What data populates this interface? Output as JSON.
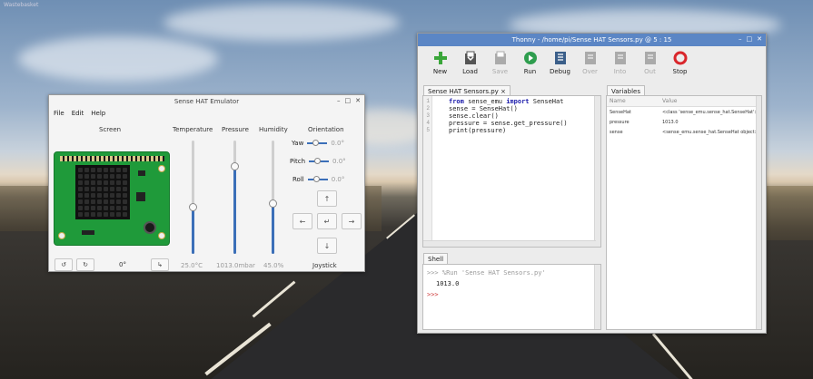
{
  "desktop": {
    "corner_text": "Wastebasket"
  },
  "emulator": {
    "title": "Sense HAT Emulator",
    "menu": [
      "File",
      "Edit",
      "Help"
    ],
    "screen_label": "Screen",
    "sensors": [
      {
        "label": "Temperature",
        "value": "25.0°C",
        "level_fraction": 0.42
      },
      {
        "label": "Pressure",
        "value": "1013.0mbar",
        "level_fraction": 0.78
      },
      {
        "label": "Humidity",
        "value": "45.0%",
        "level_fraction": 0.45
      }
    ],
    "orientation": {
      "label": "Orientation",
      "rows": [
        {
          "label": "Yaw",
          "value": "0.0°"
        },
        {
          "label": "Pitch",
          "value": "0.0°"
        },
        {
          "label": "Roll",
          "value": "0.0°"
        }
      ]
    },
    "joystick": {
      "label": "Joystick",
      "up": "↑",
      "down": "↓",
      "left": "←",
      "right": "→",
      "center": "↵"
    },
    "rotation": {
      "ccw": "↺",
      "cw": "↻",
      "angle": "0°",
      "flip": "↳"
    }
  },
  "thonny": {
    "title": "Thonny - /home/pi/Sense HAT Sensors.py @ 5 : 15",
    "toolbar": [
      {
        "label": "New",
        "icon": "plus-icon",
        "color": "#3aa63a",
        "enabled": true
      },
      {
        "label": "Load",
        "icon": "load-icon",
        "color": "#555555",
        "enabled": true
      },
      {
        "label": "Save",
        "icon": "save-icon",
        "color": "#aaaaaa",
        "enabled": false
      },
      {
        "label": "Run",
        "icon": "run-icon",
        "color": "#2f9e4f",
        "enabled": true
      },
      {
        "label": "Debug",
        "icon": "debug-icon",
        "color": "#3b5f8a",
        "enabled": true
      },
      {
        "label": "Over",
        "icon": "over-icon",
        "color": "#aaaaaa",
        "enabled": false
      },
      {
        "label": "Into",
        "icon": "into-icon",
        "color": "#aaaaaa",
        "enabled": false
      },
      {
        "label": "Out",
        "icon": "out-icon",
        "color": "#aaaaaa",
        "enabled": false
      },
      {
        "label": "Stop",
        "icon": "stop-icon",
        "color": "#d9262b",
        "enabled": true
      }
    ],
    "editor": {
      "tab": "Sense HAT Sensors.py ×",
      "lines": [
        {
          "kw": "from",
          "rest": " sense_emu ",
          "kw2": "import",
          "rest2": " SenseHat"
        },
        {
          "kw": "",
          "rest": "sense = SenseHat()",
          "kw2": "",
          "rest2": ""
        },
        {
          "kw": "",
          "rest": "sense.clear()",
          "kw2": "",
          "rest2": ""
        },
        {
          "kw": "",
          "rest": "pressure = sense.get_pressure()",
          "kw2": "",
          "rest2": ""
        },
        {
          "kw": "",
          "rest": "print(pressure)",
          "kw2": "",
          "rest2": ""
        }
      ],
      "line_numbers": [
        "1",
        "2",
        "3",
        "4",
        "5"
      ]
    },
    "shell": {
      "tab": "Shell",
      "command": ">>> %Run 'Sense HAT Sensors.py'",
      "output": "1013.0",
      "prompt": ">>>"
    },
    "variables": {
      "tab": "Variables",
      "headers": [
        "Name",
        "Value"
      ],
      "rows": [
        {
          "name": "SenseHat",
          "value": "<class 'sense_emu.sense_hat.SenseHat'>"
        },
        {
          "name": "pressure",
          "value": "1013.0"
        },
        {
          "name": "sense",
          "value": "<sense_emu.sense_hat.SenseHat object>"
        }
      ]
    }
  }
}
